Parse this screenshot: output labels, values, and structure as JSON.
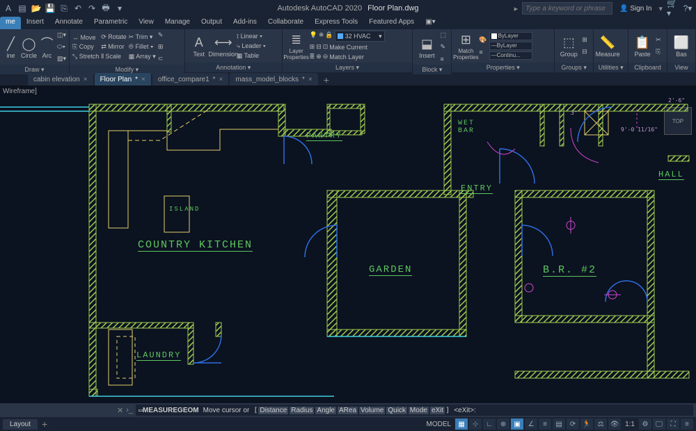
{
  "titlebar": {
    "app": "Autodesk AutoCAD 2020",
    "doc": "Floor Plan.dwg",
    "search_placeholder": "Type a keyword or phrase",
    "signin": "Sign In"
  },
  "menutabs": [
    "me",
    "Insert",
    "Annotate",
    "Parametric",
    "View",
    "Manage",
    "Output",
    "Add-ins",
    "Collaborate",
    "Express Tools",
    "Featured Apps"
  ],
  "ribbon": {
    "draw": {
      "label": "Draw ▾",
      "line": "ine",
      "circle": "Circle",
      "arc": "Arc"
    },
    "modify": {
      "label": "Modify ▾",
      "items": [
        "↔ Move",
        "⟳ Rotate",
        "✂ Trim ▾",
        "⎘ Copy",
        "⇄ Mirror",
        "⦾ Fillet ▾",
        "⤡ Stretch",
        "⫴ Scale",
        "▦ Array ▾"
      ]
    },
    "annotation": {
      "label": "Annotation ▾",
      "text": "Text",
      "dim": "Dimension",
      "items": [
        "⟟ Linear ▾",
        "⤷ Leader ▾",
        "▦ Table"
      ]
    },
    "layers": {
      "label": "Layers ▾",
      "lp": "Layer\nProperties",
      "current": "32 HVAC",
      "items": [
        "Make Current",
        "Match Layer"
      ]
    },
    "block": {
      "label": "Block ▾",
      "insert": "Insert"
    },
    "properties": {
      "label": "Properties ▾",
      "match": "Match\nProperties",
      "bylayer": "ByLayer",
      "bylayer2": "ByLayer",
      "continu": "Continu..."
    },
    "groups": {
      "label": "Groups ▾",
      "g": "Group"
    },
    "utilities": {
      "label": "Utilities ▾",
      "m": "Measure"
    },
    "clipboard": {
      "label": "Clipboard",
      "p": "Paste"
    },
    "view": {
      "label": "View",
      "b": "Bas"
    }
  },
  "doctabs": [
    {
      "name": "cabin elevation",
      "dirty": false,
      "active": false
    },
    {
      "name": "Floor Plan",
      "dirty": true,
      "active": true
    },
    {
      "name": "office_compare1",
      "dirty": true,
      "active": false
    },
    {
      "name": "mass_model_blocks",
      "dirty": true,
      "active": false
    }
  ],
  "viewport": {
    "label": "Wireframe]",
    "cube": "TOP",
    "rooms": {
      "pantry": "Pantry",
      "wetbar": "Wet\nBar",
      "island": "Island",
      "kitchen": "Country Kitchen",
      "entry": "Entry",
      "hall": "Hall",
      "garden": "Garden",
      "br2": "B.R. #2",
      "laundry": "Laundry"
    },
    "dims": {
      "a": "2'-6\"",
      "b": "9'-0 11/16\"",
      "c": "3\""
    }
  },
  "cmdline": {
    "cmd": "MEASUREGEOM",
    "prompt": "Move cursor or",
    "opts": [
      "Distance",
      "Radius",
      "Angle",
      "ARea",
      "Volume",
      "Quick",
      "Mode",
      "eXit"
    ],
    "default": "<eXit>:"
  },
  "status": {
    "layout": "Layout",
    "model": "MODEL",
    "scale": "1:1"
  }
}
